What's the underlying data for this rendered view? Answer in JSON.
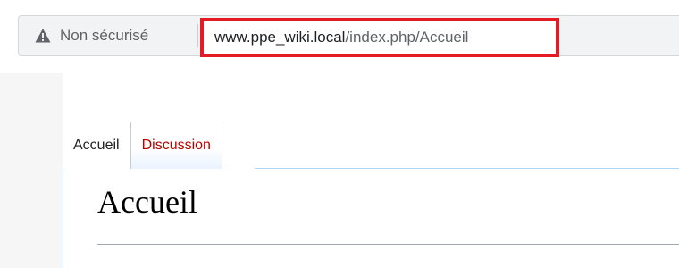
{
  "browser": {
    "security_label": "Non sécurisé",
    "url_host": "www.ppe_wiki.local",
    "url_path": "/index.php/Accueil",
    "security_icon": "warning-triangle-icon"
  },
  "tabs": [
    {
      "label": "Accueil",
      "selected": true
    },
    {
      "label": "Discussion",
      "selected": false
    }
  ],
  "main": {
    "title": "Accueil"
  },
  "colors": {
    "highlight_box": "#e41b22",
    "link_red": "#ba0000",
    "tab_border": "#a7d7f9"
  }
}
